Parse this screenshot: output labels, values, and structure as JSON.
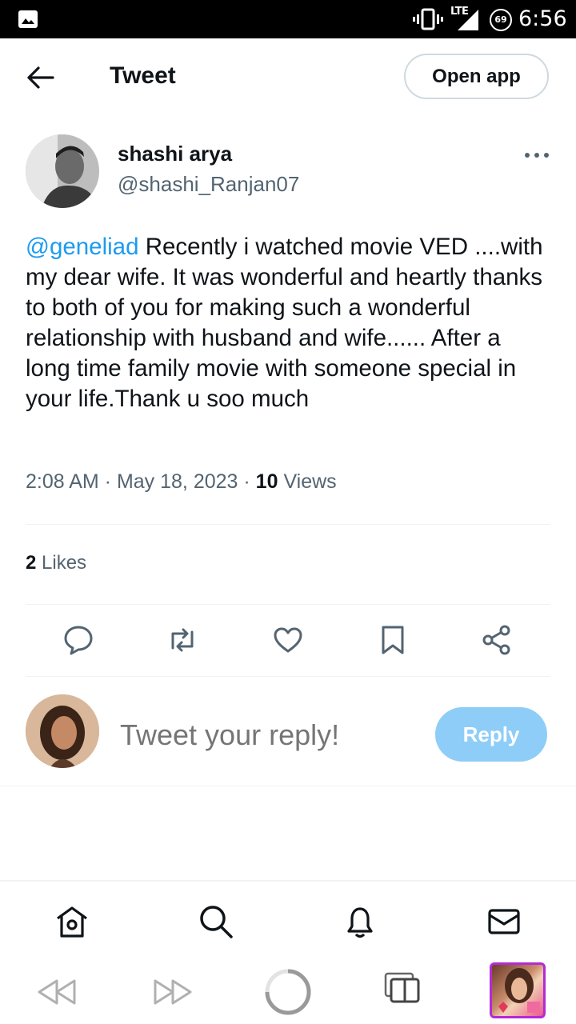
{
  "status_bar": {
    "network": "LTE",
    "battery": "69",
    "time": "6:56"
  },
  "header": {
    "title": "Tweet",
    "open_app": "Open app"
  },
  "tweet": {
    "author_name": "shashi arya",
    "author_handle": "@shashi_Ranjan07",
    "mention": "@geneliad",
    "text": " Recently i watched movie VED ....with my dear wife. It was wonderful and heartly thanks to both of you for making such a wonderful relationship with husband and wife...... After a long time family movie with someone special in your life.Thank u soo much",
    "time": "2:08 AM",
    "date": "May 18, 2023",
    "views_count": "10",
    "views_label": "Views",
    "likes_count": "2",
    "likes_label": "Likes"
  },
  "actions": [
    "reply-icon",
    "retweet-icon",
    "like-icon",
    "bookmark-icon",
    "share-icon"
  ],
  "reply": {
    "placeholder": "Tweet your reply!",
    "button": "Reply"
  },
  "colors": {
    "accent": "#1d9bf0",
    "reply_button": "#8ecdf8",
    "muted_text": "#536471",
    "thumbnail_border": "#b32ad6"
  }
}
